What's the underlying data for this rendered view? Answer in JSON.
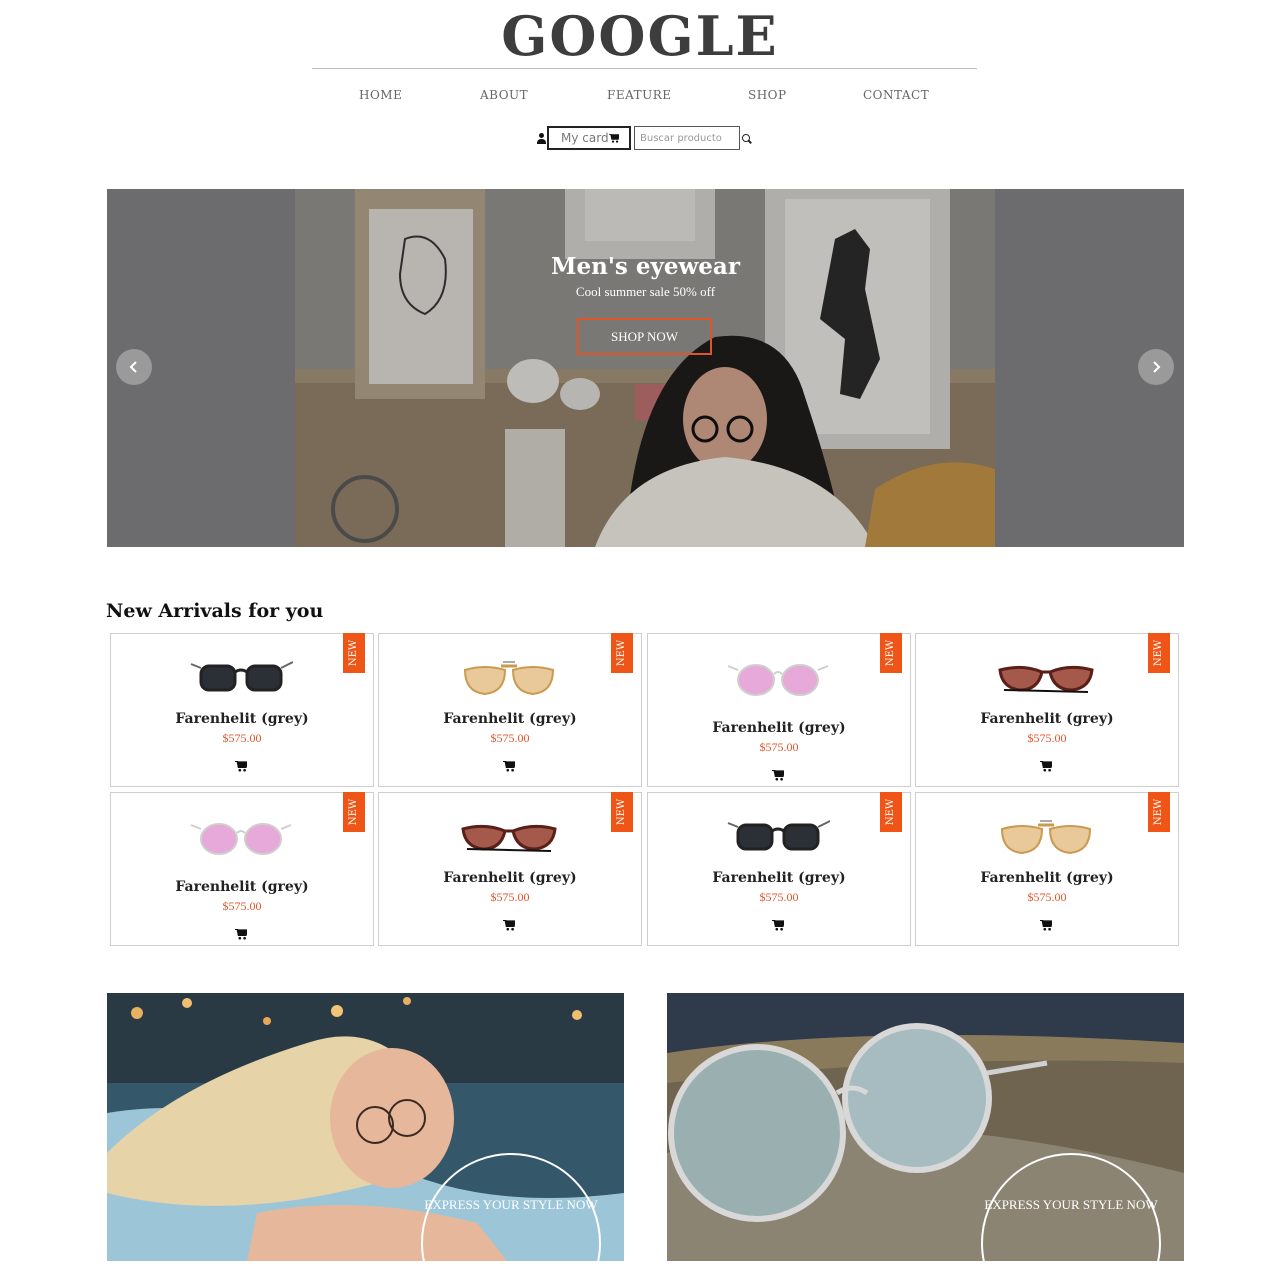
{
  "brand": {
    "logo": "GOOGLE"
  },
  "nav": {
    "items": [
      "HOME",
      "ABOUT",
      "FEATURE",
      "SHOP",
      "CONTACT"
    ]
  },
  "account": {
    "cart_label": "My card",
    "search_placeholder": "Buscar producto",
    "icons": [
      "user-icon",
      "cart-icon",
      "search-icon"
    ]
  },
  "hero": {
    "title": "Men's eyewear",
    "subtitle": "Cool summer sale 50% off",
    "cta": "SHOP NOW",
    "accent": "#e0542a"
  },
  "arrivals": {
    "title": "New Arrivals for you",
    "badge": "NEW",
    "products": [
      {
        "name": "Farenhelit (grey)",
        "price": "$575.00",
        "style": "dark-wayfarer"
      },
      {
        "name": "Farenhelit (grey)",
        "price": "$575.00",
        "style": "gold-aviator"
      },
      {
        "name": "Farenhelit (grey)",
        "price": "$575.00",
        "style": "pink-round"
      },
      {
        "name": "Farenhelit (grey)",
        "price": "$575.00",
        "style": "brown-cateye"
      },
      {
        "name": "Farenhelit (grey)",
        "price": "$575.00",
        "style": "pink-round"
      },
      {
        "name": "Farenhelit (grey)",
        "price": "$575.00",
        "style": "brown-cateye"
      },
      {
        "name": "Farenhelit (grey)",
        "price": "$575.00",
        "style": "dark-wayfarer"
      },
      {
        "name": "Farenhelit (grey)",
        "price": "$575.00",
        "style": "gold-aviator"
      }
    ]
  },
  "promos": [
    {
      "text": "Express your style now"
    },
    {
      "text": "Express your style now"
    }
  ],
  "colors": {
    "accent": "#ee5516",
    "price": "#e0542a",
    "logo": "#3d3d3d"
  }
}
